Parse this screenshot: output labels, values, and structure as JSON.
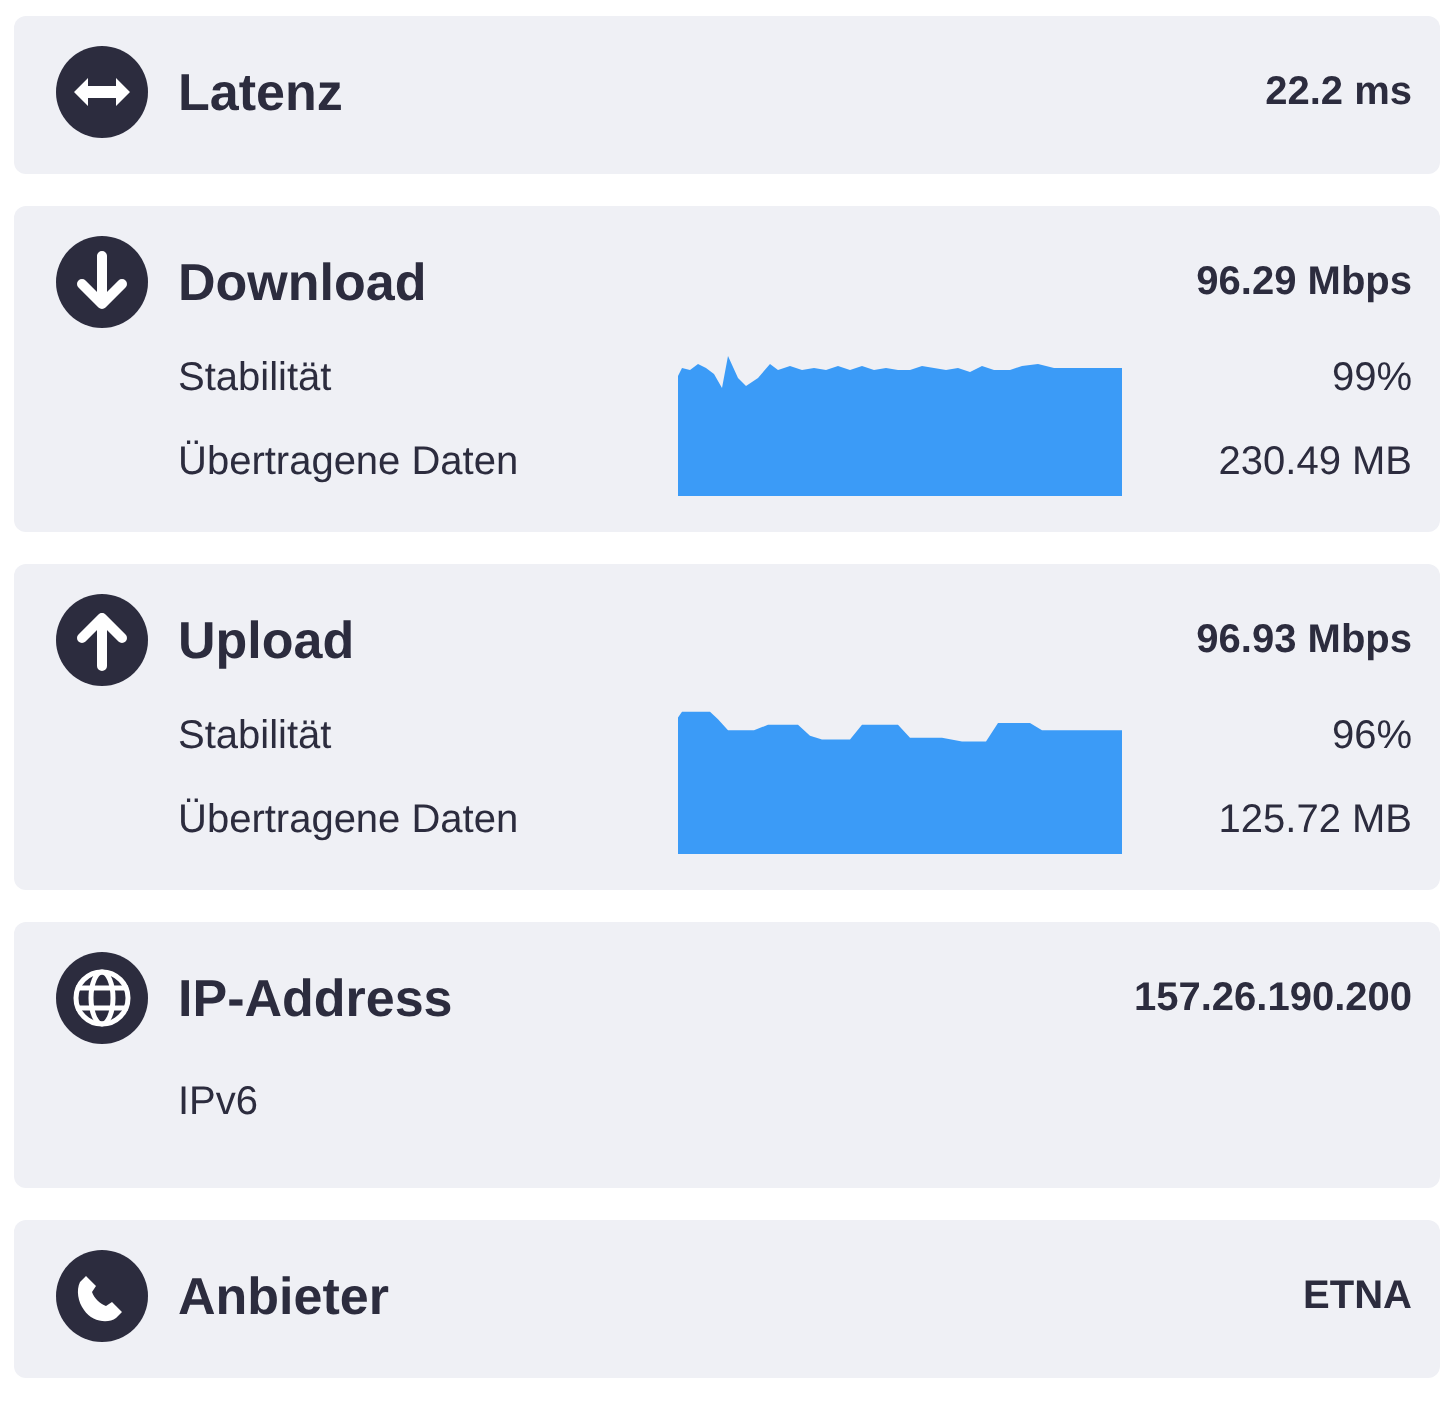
{
  "cards": [
    {
      "kind": "latency",
      "title": "Latenz",
      "value": "22.2 ms"
    },
    {
      "kind": "download",
      "title": "Download",
      "value": "96.29 Mbps",
      "rows": [
        {
          "label": "Stabilität",
          "value": "99%"
        },
        {
          "label": "Übertragene Daten",
          "value": "230.49 MB"
        }
      ]
    },
    {
      "kind": "upload",
      "title": "Upload",
      "value": "96.93 Mbps",
      "rows": [
        {
          "label": "Stabilität",
          "value": "96%"
        },
        {
          "label": "Übertragene Daten",
          "value": "125.72 MB"
        }
      ]
    },
    {
      "kind": "ip",
      "title": "IP-Address",
      "value": "157.26.190.200",
      "note": "IPv6"
    },
    {
      "kind": "provider",
      "title": "Anbieter",
      "value": "ETNA"
    }
  ]
}
